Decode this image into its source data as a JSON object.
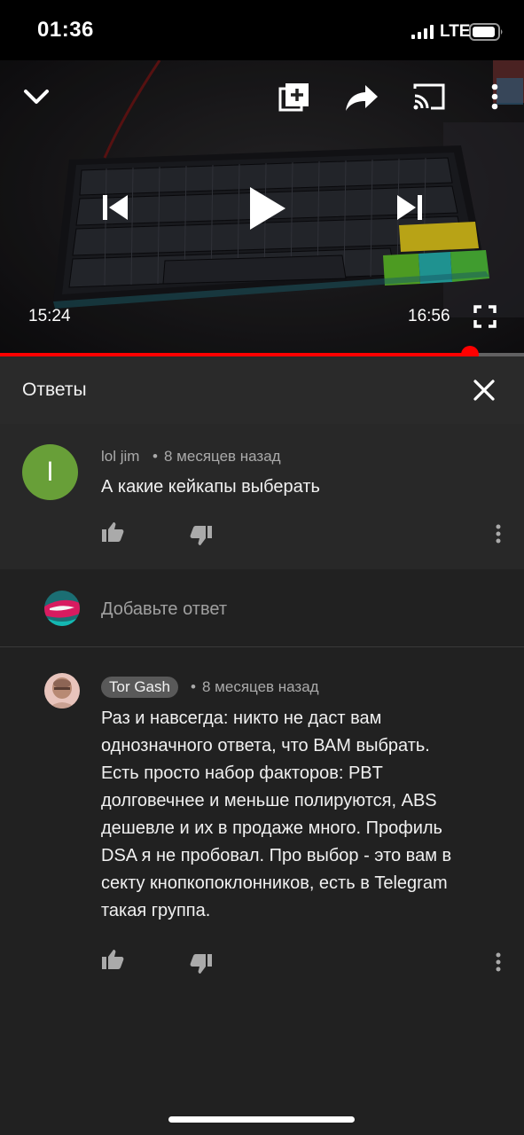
{
  "status_bar": {
    "time": "01:36",
    "network": "LTE"
  },
  "player": {
    "current_time": "15:24",
    "total_time": "16:56",
    "progress": 0.896,
    "accent_color": "#ff0000",
    "icons": [
      "chevron-down-icon",
      "add-to-playlist-icon",
      "share-icon",
      "cast-icon",
      "more-vert-icon",
      "skip-previous-icon",
      "play-icon",
      "skip-next-icon",
      "fullscreen-icon"
    ]
  },
  "replies_panel": {
    "title": "Ответы"
  },
  "parent_comment": {
    "avatar_letter": "l",
    "avatar_color": "#689f38",
    "author": "lol jim",
    "separator": "•",
    "time_ago": "8 месяцев назад",
    "text": "А какие кейкапы выберать"
  },
  "add_reply": {
    "placeholder": "Добавьте ответ"
  },
  "reply": {
    "author": "Tor Gash",
    "separator": "•",
    "time_ago": "8 месяцев назад",
    "lines": [
      "Раз и навсегда: никто не даст вам",
      "однозначного ответа, что ВАМ выбрать.",
      "Есть просто набор факторов: PBT",
      "долговечнее и меньше полируются, ABS",
      "дешевле и их в продаже много. Профиль",
      "DSA я не пробовал. Про выбор - это вам в",
      "секту кнопкопоклонников, есть в Telegram",
      "такая группа."
    ]
  }
}
